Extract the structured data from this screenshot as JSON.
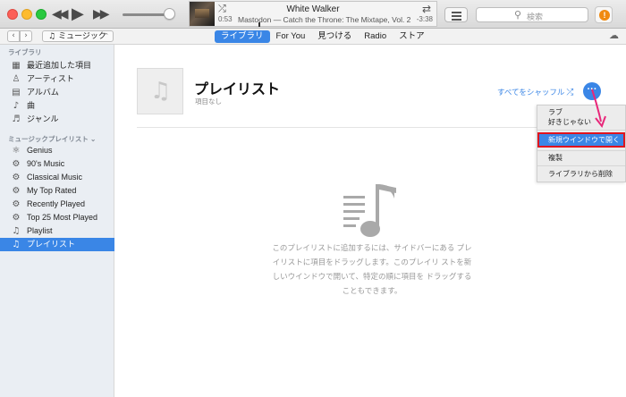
{
  "player": {
    "song_title": "White Walker",
    "song_artist_album": "Mastodon — Catch the Throne: The Mixtape, Vol. 2",
    "elapsed": "0:53",
    "remaining": "-3:38",
    "volume_percent": 90,
    "progress_fraction": 0.19
  },
  "search": {
    "placeholder": "検索"
  },
  "navbar": {
    "media_kind": "ミュージック",
    "tabs": [
      {
        "label": "ライブラリ",
        "active": true
      },
      {
        "label": "For You",
        "active": false
      },
      {
        "label": "見つける",
        "active": false
      },
      {
        "label": "Radio",
        "active": false
      },
      {
        "label": "ストア",
        "active": false
      }
    ]
  },
  "sidebar": {
    "library_header": "ライブラリ",
    "library_items": [
      {
        "label": "最近追加した項目",
        "icon": "recently-added-icon"
      },
      {
        "label": "アーティスト",
        "icon": "artist-icon"
      },
      {
        "label": "アルバム",
        "icon": "album-icon"
      },
      {
        "label": "曲",
        "icon": "note-icon"
      },
      {
        "label": "ジャンル",
        "icon": "genre-icon"
      }
    ],
    "playlists_header": "ミュージックプレイリスト",
    "playlist_items": [
      {
        "label": "Genius",
        "icon": "genius-icon",
        "selected": false
      },
      {
        "label": "90's Music",
        "icon": "gear-icon",
        "selected": false
      },
      {
        "label": "Classical Music",
        "icon": "gear-icon",
        "selected": false
      },
      {
        "label": "My Top Rated",
        "icon": "gear-icon",
        "selected": false
      },
      {
        "label": "Recently Played",
        "icon": "gear-icon",
        "selected": false
      },
      {
        "label": "Top 25 Most Played",
        "icon": "gear-icon",
        "selected": false
      },
      {
        "label": "Playlist",
        "icon": "playlist-icon",
        "selected": false
      },
      {
        "label": "プレイリスト",
        "icon": "playlist-icon",
        "selected": true
      }
    ]
  },
  "playlist": {
    "title": "プレイリスト",
    "subtitle": "項目なし",
    "shuffle_all": "すべてをシャッフル",
    "more": "···"
  },
  "context_menu": {
    "love": "ラブ",
    "dislike": "好きじゃない",
    "open_new_window": "新規ウインドウで開く",
    "duplicate": "複製",
    "delete_from_library": "ライブラリから削除"
  },
  "empty_state": {
    "message": "このプレイリストに追加するには、サイドバーにある プレイリストに項目をドラッグします。このプレイリ ストを新しいウインドウで開いて、特定の順に項目を ドラッグすることもできます。"
  },
  "colors": {
    "accent": "#3a86e6",
    "highlight_border": "#e0141e",
    "annotation_arrow": "#e8287a"
  }
}
